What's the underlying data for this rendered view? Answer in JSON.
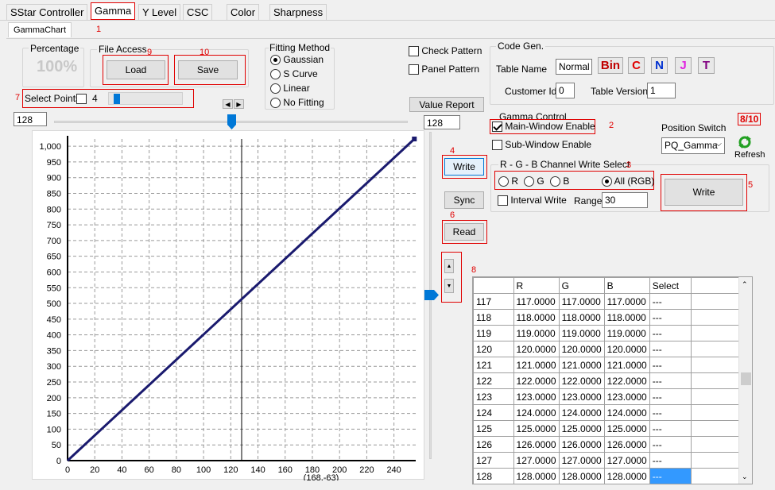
{
  "tabs": [
    "SStar Controller",
    "Gamma",
    "Y Level",
    "CSC",
    "Color",
    "Sharpness"
  ],
  "subtab": "GammaChart",
  "annotations": {
    "n1": "1",
    "n2": "2",
    "n3": "3",
    "n4": "4",
    "n5": "5",
    "n6": "6",
    "n7": "7",
    "n8": "8",
    "n9": "9",
    "n10": "10"
  },
  "percentage": {
    "label": "Percentage",
    "value": "100%"
  },
  "file_access": {
    "label": "File Access",
    "load": "Load",
    "save": "Save"
  },
  "fitting": {
    "label": "Fitting Method",
    "options": [
      "Gaussian",
      "S Curve",
      "Linear",
      "No Fitting"
    ],
    "selected": "Gaussian"
  },
  "patterns": {
    "check": "Check Pattern",
    "panel": "Panel Pattern"
  },
  "select_points": {
    "label": "Select Points",
    "value": "4",
    "slider_fraction": 0.07
  },
  "value_report": "Value Report",
  "h_slider": {
    "value": "128",
    "fraction": 0.5
  },
  "v_value": "128",
  "buttons": {
    "write_side": "Write",
    "sync": "Sync",
    "read": "Read",
    "write_main": "Write"
  },
  "code_gen": {
    "label": "Code Gen.",
    "table_name_label": "Table Name",
    "table_name": "Normal",
    "bin": "Bin",
    "c": "C",
    "n": "N",
    "j": "J",
    "t": "T",
    "customer_label": "Customer Id:",
    "customer_id": "0",
    "table_version_label": "Table Version:",
    "table_version": "1"
  },
  "gamma_control": {
    "label": "Gamma Control",
    "main_enable": "Main-Window Enable",
    "sub_enable": "Sub-Window Enable",
    "position_label": "Position Switch",
    "position_value": "PQ_Gamma",
    "counter": "8/10",
    "refresh": "Refresh"
  },
  "rgb_select": {
    "label": "R - G - B Channel Write Select",
    "options": [
      "R",
      "G",
      "B",
      "All (RGB)"
    ],
    "selected": "All (RGB)",
    "interval": "Interval Write",
    "range_label": "Range",
    "range": "30"
  },
  "table": {
    "headers": [
      "",
      "R",
      "G",
      "B",
      "Select",
      ""
    ],
    "rows": [
      [
        "117",
        "117.0000",
        "117.0000",
        "117.0000",
        "---"
      ],
      [
        "118",
        "118.0000",
        "118.0000",
        "118.0000",
        "---"
      ],
      [
        "119",
        "119.0000",
        "119.0000",
        "119.0000",
        "---"
      ],
      [
        "120",
        "120.0000",
        "120.0000",
        "120.0000",
        "---"
      ],
      [
        "121",
        "121.0000",
        "121.0000",
        "121.0000",
        "---"
      ],
      [
        "122",
        "122.0000",
        "122.0000",
        "122.0000",
        "---"
      ],
      [
        "123",
        "123.0000",
        "123.0000",
        "123.0000",
        "---"
      ],
      [
        "124",
        "124.0000",
        "124.0000",
        "124.0000",
        "---"
      ],
      [
        "125",
        "125.0000",
        "125.0000",
        "125.0000",
        "---"
      ],
      [
        "126",
        "126.0000",
        "126.0000",
        "126.0000",
        "---"
      ],
      [
        "127",
        "127.0000",
        "127.0000",
        "127.0000",
        "---"
      ],
      [
        "128",
        "128.0000",
        "128.0000",
        "128.0000",
        "---"
      ]
    ]
  },
  "chart_data": {
    "type": "line",
    "xlim": [
      0,
      256
    ],
    "ylim": [
      0,
      1023
    ],
    "x_ticks": [
      0,
      20,
      40,
      60,
      80,
      100,
      120,
      140,
      160,
      180,
      200,
      220,
      240
    ],
    "y_ticks": [
      0,
      50,
      100,
      150,
      200,
      250,
      300,
      350,
      400,
      450,
      500,
      550,
      600,
      650,
      700,
      750,
      800,
      850,
      900,
      950,
      1000
    ],
    "y_tick_labels": [
      "0",
      "50",
      "100",
      "150",
      "200",
      "250",
      "300",
      "350",
      "400",
      "450",
      "500",
      "550",
      "600",
      "650",
      "700",
      "750",
      "800",
      "850",
      "900",
      "950",
      "1,000"
    ],
    "series": [
      {
        "x": [
          0,
          255
        ],
        "y": [
          0,
          1023
        ],
        "color": "#1a1a6e"
      }
    ],
    "cursor_x": 128,
    "coord_readout": "(168,-63)",
    "grid": true
  }
}
